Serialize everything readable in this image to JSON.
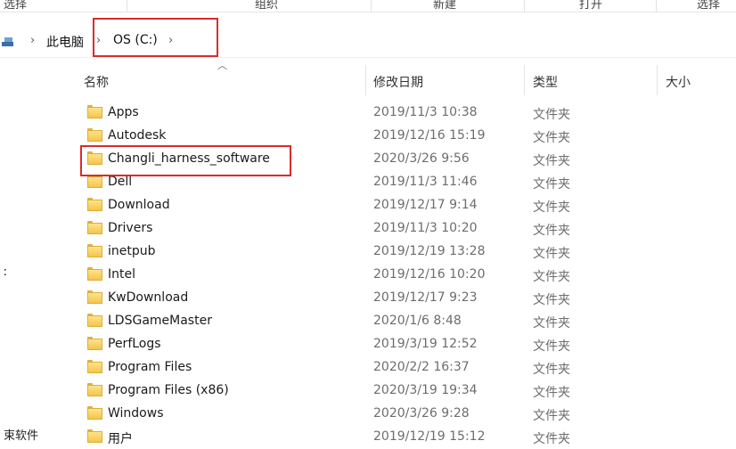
{
  "ribbon": {
    "items": [
      "选择",
      "组织",
      "新建",
      "打开",
      "选择"
    ]
  },
  "address_bar": {
    "breadcrumbs": [
      "此电脑",
      "OS (C:)"
    ]
  },
  "columns": {
    "name": "名称",
    "date": "修改日期",
    "type": "类型",
    "size": "大小"
  },
  "files": [
    {
      "name": "Apps",
      "date": "2019/11/3 10:38",
      "type": "文件夹"
    },
    {
      "name": "Autodesk",
      "date": "2019/12/16 15:19",
      "type": "文件夹"
    },
    {
      "name": "Changli_harness_software",
      "date": "2020/3/26 9:56",
      "type": "文件夹"
    },
    {
      "name": "Dell",
      "date": "2019/11/3 11:46",
      "type": "文件夹"
    },
    {
      "name": "Download",
      "date": "2019/12/17 9:14",
      "type": "文件夹"
    },
    {
      "name": "Drivers",
      "date": "2019/11/3 10:20",
      "type": "文件夹"
    },
    {
      "name": "inetpub",
      "date": "2019/12/19 13:28",
      "type": "文件夹"
    },
    {
      "name": "Intel",
      "date": "2019/12/16 10:20",
      "type": "文件夹"
    },
    {
      "name": "KwDownload",
      "date": "2019/12/17 9:23",
      "type": "文件夹"
    },
    {
      "name": "LDSGameMaster",
      "date": "2020/1/6 8:48",
      "type": "文件夹"
    },
    {
      "name": "PerfLogs",
      "date": "2019/3/19 12:52",
      "type": "文件夹"
    },
    {
      "name": "Program Files",
      "date": "2020/2/2 16:37",
      "type": "文件夹"
    },
    {
      "name": "Program Files (x86)",
      "date": "2020/3/19 19:34",
      "type": "文件夹"
    },
    {
      "name": "Windows",
      "date": "2020/3/26 9:28",
      "type": "文件夹"
    },
    {
      "name": "用户",
      "date": "2019/12/19 15:12",
      "type": "文件夹"
    }
  ],
  "nav_pane": {
    "fragment_1": "ː",
    "fragment_2": "束软件"
  },
  "colors": {
    "highlight_box": "#d82c2c",
    "folder": "#f4c54c"
  }
}
